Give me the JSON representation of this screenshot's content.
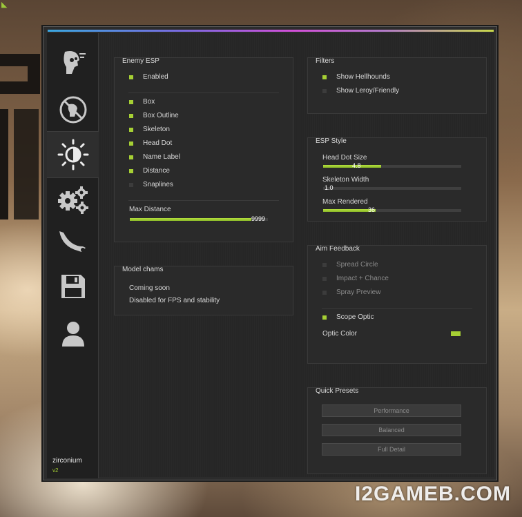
{
  "sidebar": {
    "tabs": [
      {
        "icon": "head-target-icon"
      },
      {
        "icon": "no-visibility-icon"
      },
      {
        "icon": "brightness-icon"
      },
      {
        "icon": "gears-icon"
      },
      {
        "icon": "knife-icon"
      },
      {
        "icon": "save-icon"
      },
      {
        "icon": "user-icon"
      }
    ],
    "brand_name": "zirconium",
    "brand_version": "v2"
  },
  "enemy_esp": {
    "title": "Enemy ESP",
    "enabled": {
      "label": "Enabled",
      "checked": true
    },
    "options": [
      {
        "label": "Box",
        "checked": true
      },
      {
        "label": "Box Outline",
        "checked": true
      },
      {
        "label": "Skeleton",
        "checked": true
      },
      {
        "label": "Head Dot",
        "checked": true
      },
      {
        "label": "Name Label",
        "checked": true
      },
      {
        "label": "Distance",
        "checked": true
      },
      {
        "label": "Snaplines",
        "checked": false
      }
    ],
    "max_distance": {
      "label": "Max Distance",
      "value": "9999",
      "fraction": 0.88
    }
  },
  "model_chams": {
    "title": "Model chams",
    "line1": "Coming soon",
    "line2": "Disabled for FPS and stability"
  },
  "filters": {
    "title": "Filters",
    "options": [
      {
        "label": "Show Hellhounds",
        "checked": true
      },
      {
        "label": "Show Leroy/Friendly",
        "checked": false
      }
    ]
  },
  "esp_style": {
    "title": "ESP Style",
    "sliders": [
      {
        "label": "Head Dot Size",
        "value": "4.8",
        "fraction": 0.42
      },
      {
        "label": "Skeleton Width",
        "value": "1.0",
        "fraction": 0.0
      },
      {
        "label": "Max Rendered",
        "value": "36",
        "fraction": 0.38
      }
    ]
  },
  "aim_feedback": {
    "title": "Aim Feedback",
    "options": [
      {
        "label": "Spread Circle",
        "checked": false,
        "disabled": true
      },
      {
        "label": "Impact + Chance",
        "checked": false,
        "disabled": true
      },
      {
        "label": "Spray Preview",
        "checked": false,
        "disabled": true
      }
    ],
    "scope_optic": {
      "label": "Scope Optic",
      "checked": true
    },
    "optic_color": {
      "label": "Optic Color",
      "color": "#a6d034"
    }
  },
  "quick_presets": {
    "title": "Quick Presets",
    "buttons": [
      "Performance",
      "Balanced",
      "Full Detail"
    ]
  },
  "watermark": "I2GAMEB.COM"
}
